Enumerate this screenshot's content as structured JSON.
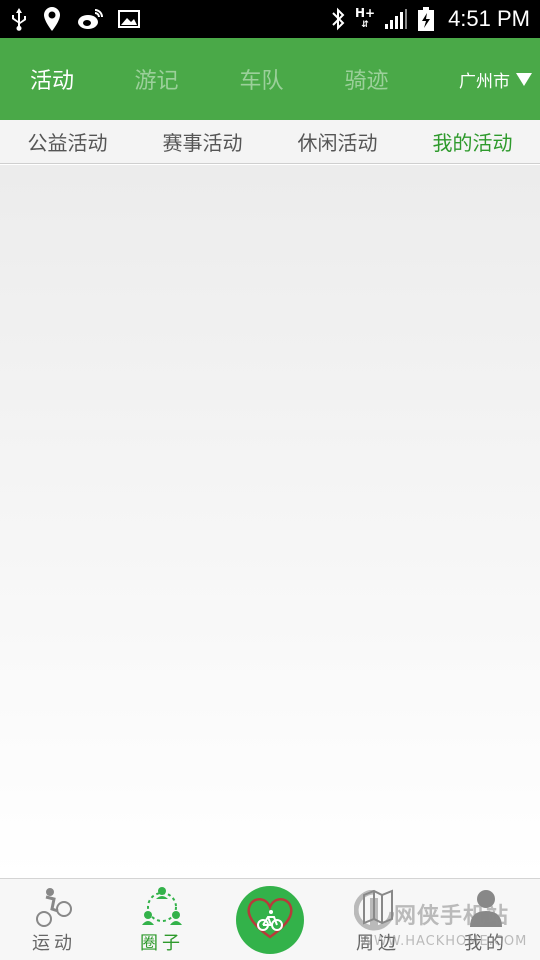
{
  "status_bar": {
    "time": "4:51 PM",
    "network_label": "H+"
  },
  "header": {
    "tabs": [
      {
        "label": "活动",
        "active": true
      },
      {
        "label": "游记",
        "active": false
      },
      {
        "label": "车队",
        "active": false
      },
      {
        "label": "骑迹",
        "active": false
      }
    ],
    "city": "广州市"
  },
  "sub_tabs": [
    {
      "label": "公益活动",
      "active": false
    },
    {
      "label": "赛事活动",
      "active": false
    },
    {
      "label": "休闲活动",
      "active": false
    },
    {
      "label": "我的活动",
      "active": true
    }
  ],
  "bottom_nav": {
    "items": [
      {
        "label": "运动",
        "icon": "cyclist-icon",
        "active": false
      },
      {
        "label": "圈子",
        "icon": "circle-group-icon",
        "active": true
      },
      {
        "label": "周边",
        "icon": "nearby-icon",
        "active": false
      },
      {
        "label": "我的",
        "icon": "user-icon",
        "active": false
      }
    ],
    "center_icon": "heart-bike-icon"
  },
  "watermark": {
    "main": "网侠手机站",
    "sub": "WWW.HACKHOME.COM"
  },
  "colors": {
    "header_green": "#4aa948",
    "active_green": "#2e9a2c",
    "center_button": "#33b24a"
  }
}
